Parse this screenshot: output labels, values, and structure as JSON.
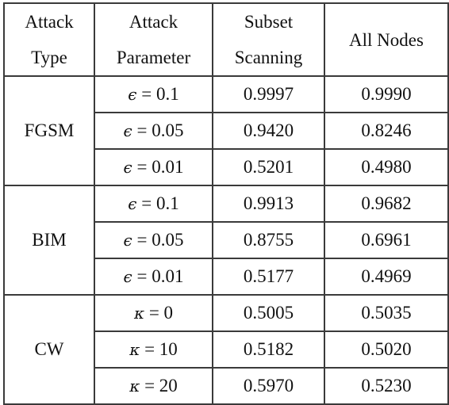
{
  "table": {
    "headers": [
      {
        "line1": "Attack",
        "line2": "Type"
      },
      {
        "line1": "Attack",
        "line2": "Parameter"
      },
      {
        "line1": "Subset",
        "line2": "Scanning"
      },
      {
        "line1": "All Nodes",
        "line2": ""
      }
    ],
    "groups": [
      {
        "attack_type": "FGSM",
        "rows": [
          {
            "symbol": "ϵ",
            "op": " = ",
            "param": "0.1",
            "subset_scanning": "0.9997",
            "all_nodes": "0.9990"
          },
          {
            "symbol": "ϵ",
            "op": " = ",
            "param": "0.05",
            "subset_scanning": "0.9420",
            "all_nodes": "0.8246"
          },
          {
            "symbol": "ϵ",
            "op": " = ",
            "param": "0.01",
            "subset_scanning": "0.5201",
            "all_nodes": "0.4980"
          }
        ]
      },
      {
        "attack_type": "BIM",
        "rows": [
          {
            "symbol": "ϵ",
            "op": " = ",
            "param": "0.1",
            "subset_scanning": "0.9913",
            "all_nodes": "0.9682"
          },
          {
            "symbol": "ϵ",
            "op": " = ",
            "param": "0.05",
            "subset_scanning": "0.8755",
            "all_nodes": "0.6961"
          },
          {
            "symbol": "ϵ",
            "op": " = ",
            "param": "0.01",
            "subset_scanning": "0.5177",
            "all_nodes": "0.4969"
          }
        ]
      },
      {
        "attack_type": "CW",
        "rows": [
          {
            "symbol": "κ",
            "op": " = ",
            "param": "0",
            "subset_scanning": "0.5005",
            "all_nodes": "0.5035"
          },
          {
            "symbol": "κ",
            "op": " = ",
            "param": "10",
            "subset_scanning": "0.5182",
            "all_nodes": "0.5020"
          },
          {
            "symbol": "κ",
            "op": " = ",
            "param": "20",
            "subset_scanning": "0.5970",
            "all_nodes": "0.5230"
          }
        ]
      }
    ]
  }
}
